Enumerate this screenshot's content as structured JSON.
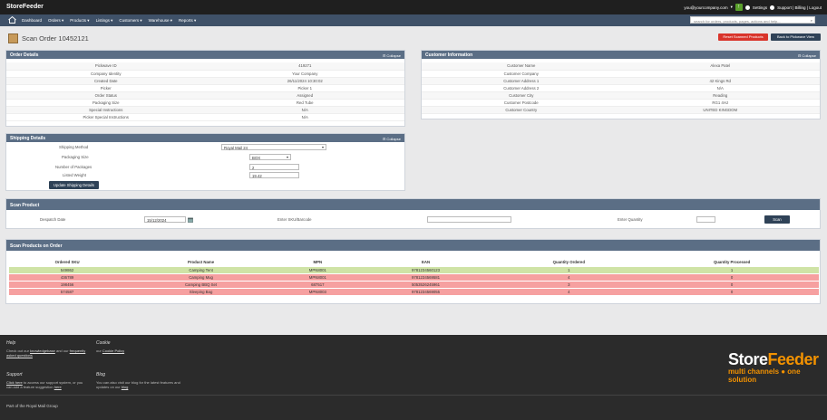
{
  "app": {
    "brand": "StoreFeeder"
  },
  "topbar": {
    "user": "you@yourcompany.com",
    "settings": "Settings",
    "links": "Support | Billing | Logout"
  },
  "nav": {
    "items": [
      "Dashboard",
      "Orders ▾",
      "Products ▾",
      "Listings ▾",
      "Customers ▾",
      "Warehouse ▾",
      "Reports ▾"
    ],
    "search_placeholder": "search for orders, products, pages, actions and help..."
  },
  "page": {
    "title": "Scan Order 10452121",
    "reset_button": "Reset Scanned Products",
    "back_button": "Back to Pickwave View"
  },
  "order_details": {
    "title": "Order Details",
    "collapse": "⊟ Collapse",
    "rows": [
      {
        "label": "Pickwave ID",
        "value": "419271"
      },
      {
        "label": "Company Identity",
        "value": "Your Company"
      },
      {
        "label": "Created Date",
        "value": "26/11/2024 10:30:02"
      },
      {
        "label": "Picker",
        "value": "Picker 1"
      },
      {
        "label": "Order Status",
        "value": "Assigned"
      },
      {
        "label": "Packaging Size",
        "value": "Red Tube"
      },
      {
        "label": "Special Instructions",
        "value": "N/A"
      },
      {
        "label": "Picker Special Instructions",
        "value": "N/A"
      }
    ]
  },
  "customer_info": {
    "title": "Customer Information",
    "collapse": "⊟ Collapse",
    "rows": [
      {
        "label": "Customer Name",
        "value": "Alexa Patel"
      },
      {
        "label": "Customer Company",
        "value": ""
      },
      {
        "label": "Customer Address 1",
        "value": "42 Kings Rd"
      },
      {
        "label": "Customer Address 2",
        "value": "N/A"
      },
      {
        "label": "Customer City",
        "value": "Reading"
      },
      {
        "label": "Customer Postcode",
        "value": "RG1 4HJ"
      },
      {
        "label": "Customer Country",
        "value": "UNITED KINGDOM"
      }
    ]
  },
  "shipping": {
    "title": "Shipping Details",
    "collapse": "⊟ Collapse",
    "method_label": "Shipping Method",
    "method_value": "Royal Mail 24",
    "packaging_label": "Packaging Size",
    "packaging_value": "BOX",
    "packages_label": "Number of Packages",
    "packages_value": "2",
    "weight_label": "Listed Weight",
    "weight_value": "19.42",
    "update_button": "Update Shipping Details"
  },
  "scan": {
    "title": "Scan Product",
    "dispatch_label": "Despatch Date",
    "dispatch_value": "15/12/2024",
    "sku_label": "Enter SKU/Barcode",
    "qty_label": "Enter Quantity",
    "scan_button": "Scan"
  },
  "products": {
    "title": "Scan Products on Order",
    "headers": [
      "Ordered SKU",
      "Product Name",
      "MPN",
      "EAN",
      "Quantity Ordered",
      "Quantity Processed"
    ],
    "rows": [
      {
        "sku": "549862",
        "name": "Camping Tent",
        "mpn": "MPN8001",
        "ean": "9781234560123",
        "qty": "1",
        "processed": "1",
        "status": "ok"
      },
      {
        "sku": "436789",
        "name": "Camping Mug",
        "mpn": "MPN8001",
        "ean": "9781234569581",
        "qty": "4",
        "processed": "0",
        "status": "bad"
      },
      {
        "sku": "198456",
        "name": "Camping BBQ Set",
        "mpn": "687517",
        "ean": "5053526245961",
        "qty": "3",
        "processed": "0",
        "status": "bad"
      },
      {
        "sku": "574587",
        "name": "Sleeping Bag",
        "mpn": "MPN8003",
        "ean": "9781234569055",
        "qty": "4",
        "processed": "0",
        "status": "bad"
      }
    ]
  },
  "footer": {
    "help_title": "Help",
    "help_line1": "Check out our",
    "help_link1": "knowledgebase",
    "help_line2": "and our",
    "help_link2": "frequently asked questions",
    "cookie_title": "Cookie",
    "cookie_text": "our",
    "cookie_link": "Cookie Policy",
    "support_title": "Support",
    "support_link": "Click here",
    "support_text": "to access our support system, or you can add a feature suggestion",
    "support_link2": "here",
    "blog_title": "Blog",
    "blog_text": "You can also visit our blog for the latest features and updates on our",
    "blog_link": "blog",
    "logo_part1": "Store",
    "logo_part2": "Feeder",
    "tagline": "multi channels ● one solution",
    "bottom": "Part of the Royal Mail Group"
  },
  "colors": {
    "nav": "#3f5168",
    "panel_header": "#5b6e85",
    "ok_row": "#cfe3a6",
    "bad_row": "#f6a0a0",
    "accent": "#f39200"
  }
}
